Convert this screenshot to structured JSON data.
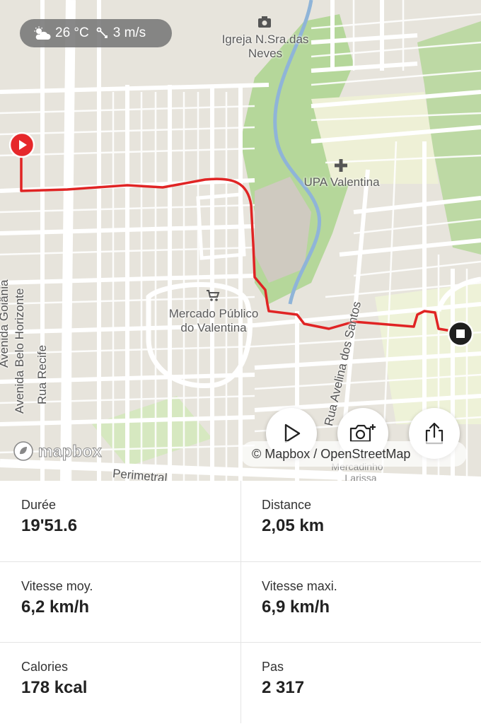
{
  "map": {
    "weather": {
      "temperature": "26 °C",
      "wind": "3 m/s",
      "weather_icon": "cloud-sun-icon",
      "wind_icon": "wind-icon"
    },
    "labels": {
      "igreja": "Igreja N.Sra.das\nNeves",
      "upa": "UPA Valentina",
      "mercado": "Mercado Público\ndo Valentina",
      "merca_bottom": "Mercadinho",
      "larissa": "Larissa"
    },
    "streets": {
      "goiania": "Avenida Goiânia",
      "belo_horizonte": "Avenida Belo Horizonte",
      "recife": "Rua Recife",
      "avelina": "Rua Avelina dos Santos",
      "perimetral": "Perimetral"
    },
    "attribution": "© Mapbox / OpenStreetMap",
    "logo": "mapbox",
    "route_color": "#e02424",
    "start_marker_color": "#e6282b",
    "end_marker_color": "#1f1f1f",
    "park_color": "#b5d79a"
  },
  "actions": {
    "play_icon": "play-icon",
    "camera_icon": "camera-plus-icon",
    "share_icon": "share-icon"
  },
  "stats": [
    {
      "label": "Durée",
      "value": "19'51.6"
    },
    {
      "label": "Distance",
      "value": "2,05 km"
    },
    {
      "label": "Vitesse moy.",
      "value": "6,2 km/h"
    },
    {
      "label": "Vitesse maxi.",
      "value": "6,9 km/h"
    },
    {
      "label": "Calories",
      "value": "178 kcal"
    },
    {
      "label": "Pas",
      "value": "2 317"
    }
  ]
}
